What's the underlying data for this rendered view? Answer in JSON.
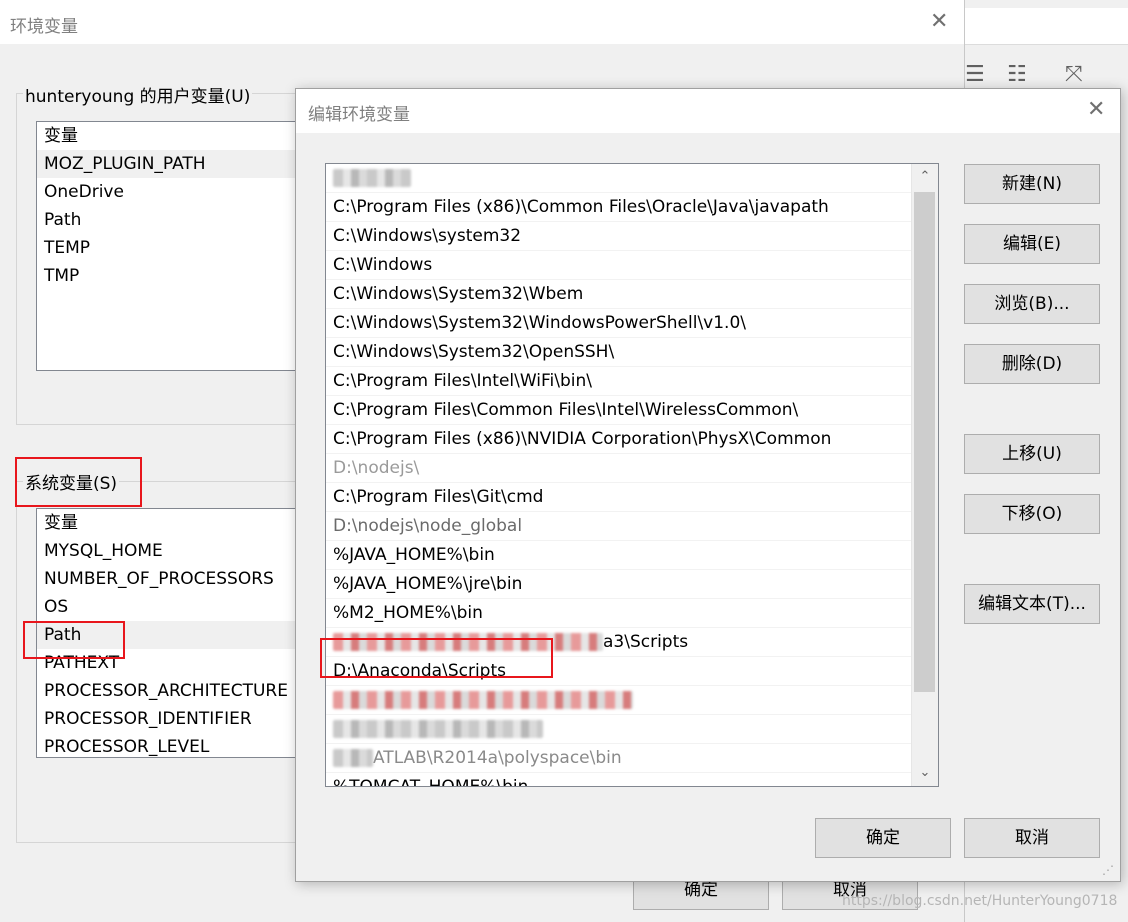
{
  "background_window": {
    "toolbar_icons": [
      "list-icon",
      "indent-list-icon",
      "expand-icon"
    ]
  },
  "env_window": {
    "title": "环境变量",
    "user_vars": {
      "label": "hunteryoung 的用户变量(U)",
      "header": "变量",
      "items": [
        "MOZ_PLUGIN_PATH",
        "OneDrive",
        "Path",
        "TEMP",
        "TMP"
      ]
    },
    "system_vars": {
      "label": "系统变量(S)",
      "header": "变量",
      "items": [
        "MYSQL_HOME",
        "NUMBER_OF_PROCESSORS",
        "OS",
        "Path",
        "PATHEXT",
        "PROCESSOR_ARCHITECTURE",
        "PROCESSOR_IDENTIFIER",
        "PROCESSOR_LEVEL"
      ]
    },
    "ok_label": "确定",
    "cancel_label": "取消"
  },
  "edit_dialog": {
    "title": "编辑环境变量",
    "paths": [
      "",
      "C:\\Program Files (x86)\\Common Files\\Oracle\\Java\\javapath",
      "C:\\Windows\\system32",
      "C:\\Windows",
      "C:\\Windows\\System32\\Wbem",
      "C:\\Windows\\System32\\WindowsPowerShell\\v1.0\\",
      "C:\\Windows\\System32\\OpenSSH\\",
      "C:\\Program Files\\Intel\\WiFi\\bin\\",
      "C:\\Program Files\\Common Files\\Intel\\WirelessCommon\\",
      "C:\\Program Files (x86)\\NVIDIA Corporation\\PhysX\\Common",
      "D:\\nodejs\\",
      "C:\\Program Files\\Git\\cmd",
      "D:\\nodejs\\node_global",
      "%JAVA_HOME%\\bin",
      "%JAVA_HOME%\\jre\\bin",
      "%M2_HOME%\\bin",
      "a3\\Scripts",
      "D:\\Anaconda\\Scripts",
      "",
      "",
      "ATLAB\\R2014a\\polyspace\\bin",
      "%TOMCAT_HOME%\\bin"
    ],
    "buttons": {
      "new": "新建(N)",
      "edit": "编辑(E)",
      "browse": "浏览(B)...",
      "delete": "删除(D)",
      "move_up": "上移(U)",
      "move_down": "下移(O)",
      "edit_text": "编辑文本(T)...",
      "ok": "确定",
      "cancel": "取消"
    }
  },
  "watermark": "https://blog.csdn.net/HunterYoung0718"
}
